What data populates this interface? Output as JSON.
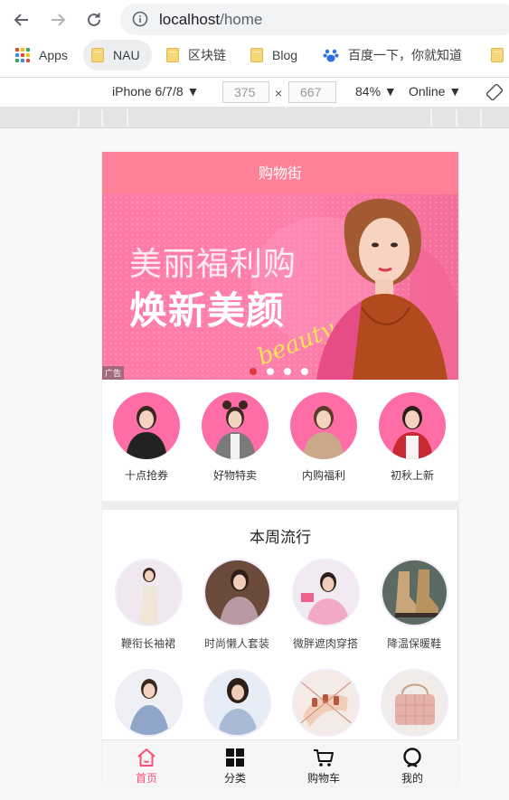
{
  "browser": {
    "url_host": "localhost",
    "url_path": "/home",
    "bookmarks": [
      {
        "label": "Apps",
        "icon": "apps-grid-icon"
      },
      {
        "label": "NAU",
        "icon": "folder-icon"
      },
      {
        "label": "区块链",
        "icon": "folder-icon"
      },
      {
        "label": "Blog",
        "icon": "folder-icon"
      },
      {
        "label": "百度一下，你就知道",
        "icon": "baidu-paw-icon"
      }
    ]
  },
  "device_toolbar": {
    "device": "iPhone 6/7/8 ▼",
    "width": "375",
    "times": "×",
    "height": "667",
    "zoom": "84% ▼",
    "network": "Online ▼"
  },
  "app": {
    "header_title": "购物街",
    "banner": {
      "line1": "美丽福利购",
      "line2": "焕新美颜",
      "script": "beauty",
      "ad_tag": "广告",
      "pages": 4,
      "active_page": 1
    },
    "quick_links": [
      {
        "label": "十点抢券"
      },
      {
        "label": "好物特卖"
      },
      {
        "label": "内购福利"
      },
      {
        "label": "初秋上新"
      }
    ],
    "weekly": {
      "title": "本周流行",
      "items": [
        {
          "label": "鞭衔长袖裙"
        },
        {
          "label": "时尚懒人套装"
        },
        {
          "label": "微胖遮肉穿搭"
        },
        {
          "label": "降温保暖鞋"
        },
        {
          "label": ""
        },
        {
          "label": ""
        },
        {
          "label": ""
        },
        {
          "label": ""
        }
      ]
    },
    "tabbar": [
      {
        "label": "首页",
        "icon": "home-icon",
        "active": true
      },
      {
        "label": "分类",
        "icon": "category-grid-icon",
        "active": false
      },
      {
        "label": "购物车",
        "icon": "cart-icon",
        "active": false
      },
      {
        "label": "我的",
        "icon": "profile-icon",
        "active": false
      }
    ]
  },
  "colors": {
    "header": "#ff8198",
    "active_tab": "#ff4f79",
    "avatar_ring": "#ff6da7"
  }
}
